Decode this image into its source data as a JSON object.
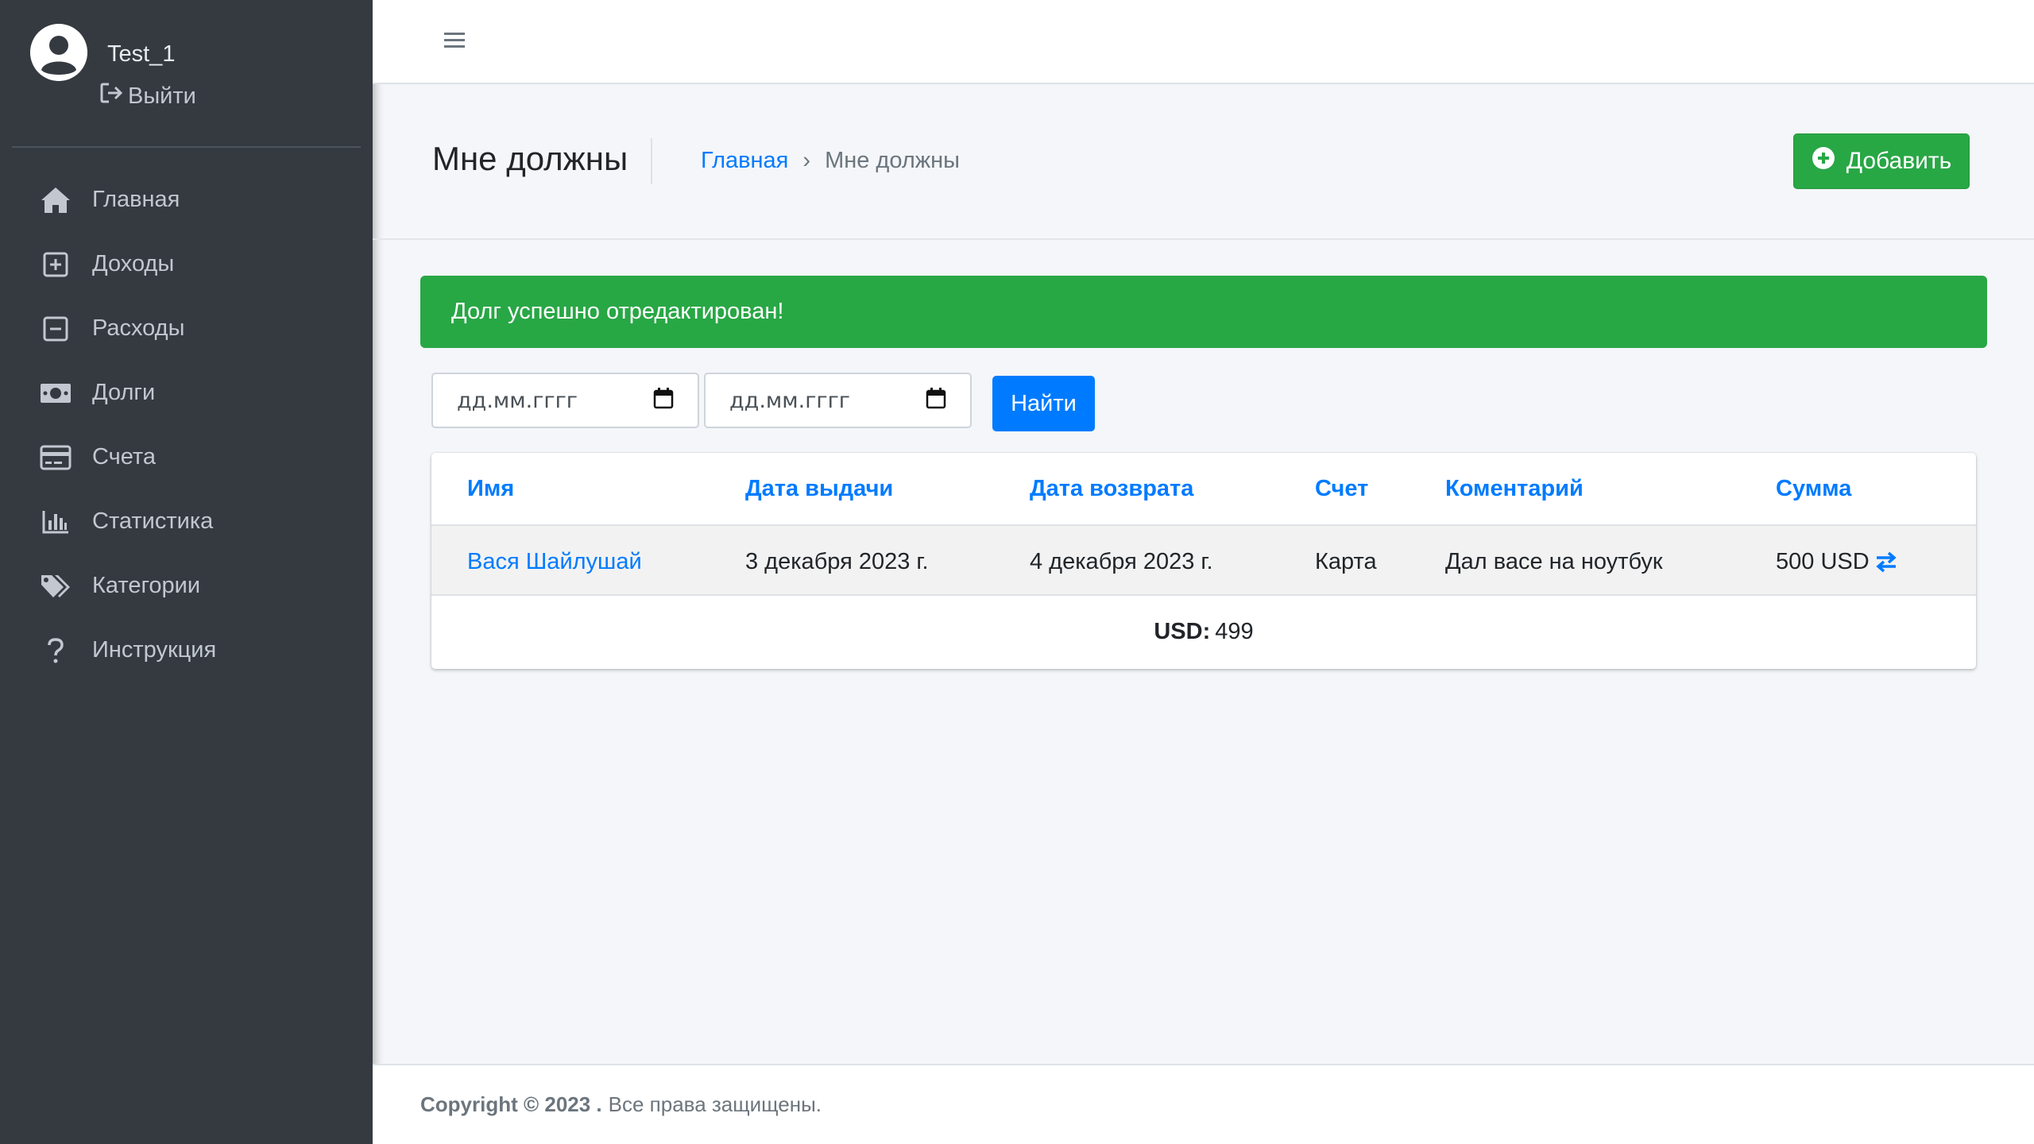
{
  "user": {
    "name": "Test_1",
    "logout_label": "Выйти"
  },
  "sidebar": {
    "items": [
      {
        "label": "Главная",
        "icon": "home-icon"
      },
      {
        "label": "Доходы",
        "icon": "plus-square-icon"
      },
      {
        "label": "Расходы",
        "icon": "minus-square-icon"
      },
      {
        "label": "Долги",
        "icon": "money-bill-icon"
      },
      {
        "label": "Счета",
        "icon": "credit-card-icon"
      },
      {
        "label": "Статистика",
        "icon": "chart-bar-icon"
      },
      {
        "label": "Категории",
        "icon": "tags-icon"
      },
      {
        "label": "Инструкция",
        "icon": "question-icon"
      }
    ]
  },
  "header": {
    "title": "Мне должны",
    "breadcrumb": {
      "home": "Главная",
      "separator": "›",
      "current": "Мне должны"
    },
    "add_label": "Добавить"
  },
  "alert": {
    "text": "Долг успешно отредактирован!"
  },
  "filter": {
    "date_from_placeholder": "дд.мм.гггг",
    "date_to_placeholder": "дд.мм.гггг",
    "find_label": "Найти"
  },
  "table": {
    "columns": [
      "Имя",
      "Дата выдачи",
      "Дата возврата",
      "Счет",
      "Коментарий",
      "Сумма"
    ],
    "rows": [
      {
        "name": "Вася Шайлушай",
        "issue_date": "3 декабря 2023 г.",
        "return_date": "4 декабря 2023 г.",
        "account": "Карта",
        "comment": "Дал васе на ноутбук",
        "amount": "500 USD"
      }
    ],
    "total": {
      "label": "USD:",
      "value": "499"
    }
  },
  "footer": {
    "copyright": "Copyright © 2023 .",
    "rights": "Все права защищены."
  },
  "colors": {
    "sidebar": "#343a40",
    "primary": "#007bff",
    "success": "#28a745"
  }
}
